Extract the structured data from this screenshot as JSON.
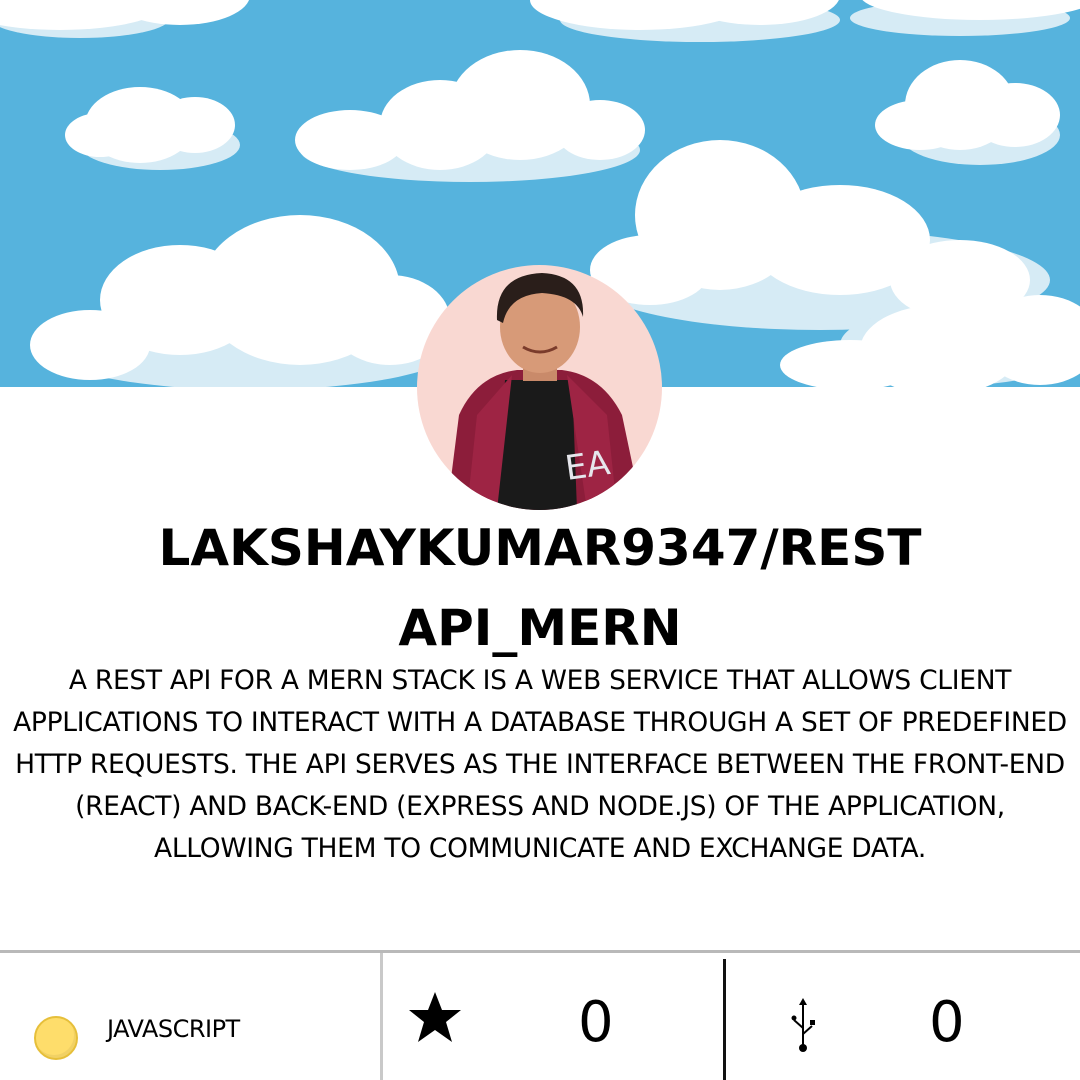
{
  "repo": {
    "title_line1": "LAKSHAYKUMAR9347/REST",
    "title_line2": "API_MERN",
    "description": "A REST API FOR A MERN STACK IS A WEB SERVICE THAT ALLOWS CLIENT APPLICATIONS TO INTERACT WITH A DATABASE THROUGH A SET OF PREDEFINED HTTP REQUESTS. THE API SERVES AS THE INTERFACE BETWEEN THE FRONT-END (REACT) AND BACK-END (EXPRESS AND NODE.JS) OF THE APPLICATION, ALLOWING THEM TO COMMUNICATE AND EXCHANGE DATA."
  },
  "stats": {
    "language": "JAVASCRIPT",
    "language_color": "#fedd6b",
    "stars": "0",
    "forks": "0",
    "star_icon": "star-icon",
    "fork_icon": "usb-fork-icon"
  },
  "colors": {
    "sky": "#56b3dd",
    "cloud": "#ffffff",
    "cloud_shade": "#d6ebf5",
    "avatar_bg": "#f9d8d2"
  }
}
